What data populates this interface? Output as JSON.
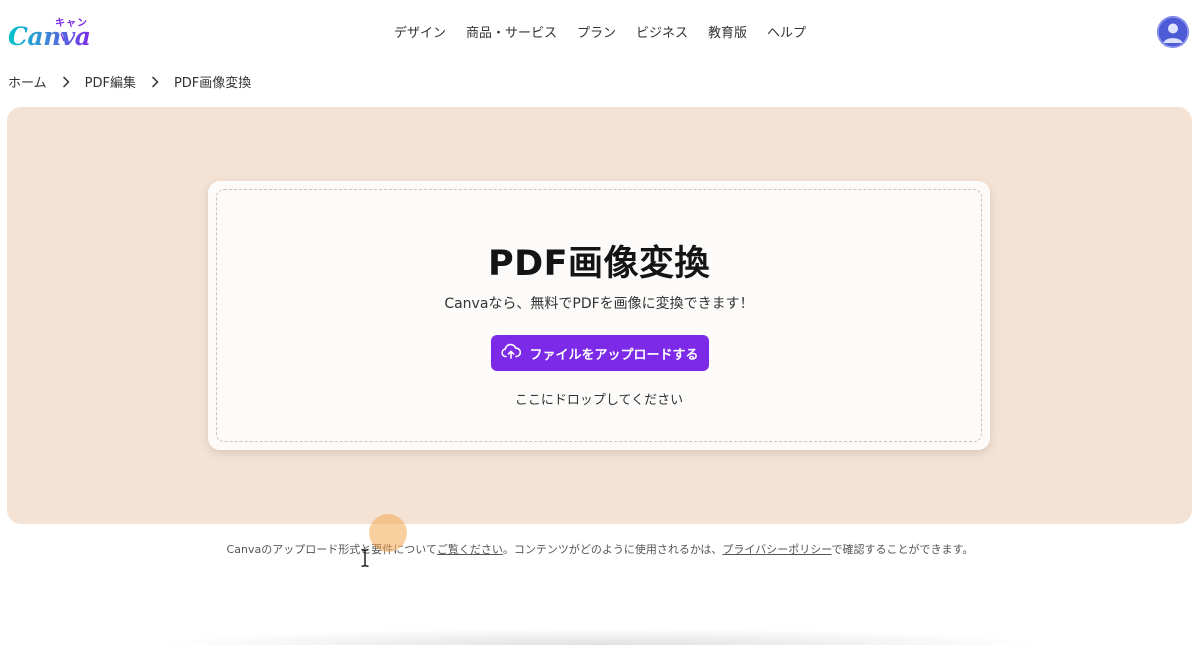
{
  "header": {
    "logo_text": "Canva",
    "logo_kana": "キャンバ",
    "nav": [
      "デザイン",
      "商品・サービス",
      "プラン",
      "ビジネス",
      "教育版",
      "ヘルプ"
    ]
  },
  "breadcrumb": [
    "ホーム",
    "PDF編集",
    "PDF画像変換"
  ],
  "main": {
    "title": "PDF画像変換",
    "subtitle": "Canvaなら、無料でPDFを画像に変換できます！",
    "upload_button": "ファイルをアップロードする",
    "drop_hint": "ここにドロップしてください"
  },
  "footer": {
    "part1": "Canvaのアップロード形式と要件について",
    "link1": "ご覧ください",
    "part2": "。コンテンツがどのように使用されるかは、",
    "link2": "プライバシーポリシー",
    "part3": "で確認することができます。"
  },
  "colors": {
    "brand_purple": "#7d2ae8",
    "hero_background": "#f4e3d5",
    "avatar": "#4e5bd6"
  },
  "icons": [
    "chevron-right-icon",
    "cloud-upload-icon",
    "user-avatar-icon",
    "text-cursor-icon"
  ]
}
